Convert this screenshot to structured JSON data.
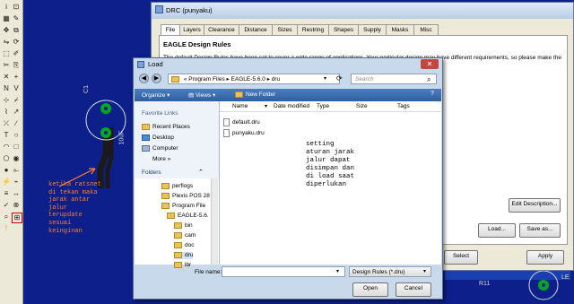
{
  "canvas": {
    "component_label": "C1",
    "component_value": "10uF",
    "resistor_label": "R11",
    "led_label": "LE",
    "annotation_left": "ketika ratsnet\ndi tekan maka\njarak antar\njalur\nterupdate\nsesuai\nkeinginan",
    "annotation_center": "setting\naturan jarak\njalur dapat\ndisimpan dan\ndi load saat\ndiperlukan"
  },
  "drc": {
    "title": "DRC (punyaku)",
    "tabs": [
      "File",
      "Layers",
      "Clearance",
      "Distance",
      "Sizes",
      "Restring",
      "Shapes",
      "Supply",
      "Masks",
      "Misc"
    ],
    "heading": "EAGLE Design Rules",
    "description": "The default Design Rules have been set to cover a wide range of applications. Your particular design may have different requirements, so please make the",
    "edit_description_label": "Edit Description...",
    "load_label": "Load...",
    "save_as_label": "Save as...",
    "select_label": "Select",
    "apply_label": "Apply"
  },
  "load": {
    "title": "Load",
    "path": [
      "Program Files",
      "EAGLE-5.6.0",
      "dru"
    ],
    "search_placeholder": "Search",
    "organize_label": "Organize",
    "views_label": "Views",
    "new_folder_label": "New Folder",
    "favorite_links_heading": "Favorite Links",
    "favorites": [
      "Recent Places",
      "Desktop",
      "Computer",
      "More"
    ],
    "folders_heading": "Folders",
    "folder_tree": [
      "perflogs",
      "Plexis POS 28",
      "Program File",
      "EAGLE-5.6.",
      "bin",
      "cam",
      "doc",
      "dru",
      "lbr"
    ],
    "columns": [
      "Name",
      "Date modified",
      "Type",
      "Size",
      "Tags"
    ],
    "files": [
      "default.dru",
      "punyaku.dru"
    ],
    "file_name_label": "File name:",
    "file_name_value": "",
    "file_type_value": "Design Rules (*.dru)",
    "open_label": "Open",
    "cancel_label": "Cancel"
  }
}
